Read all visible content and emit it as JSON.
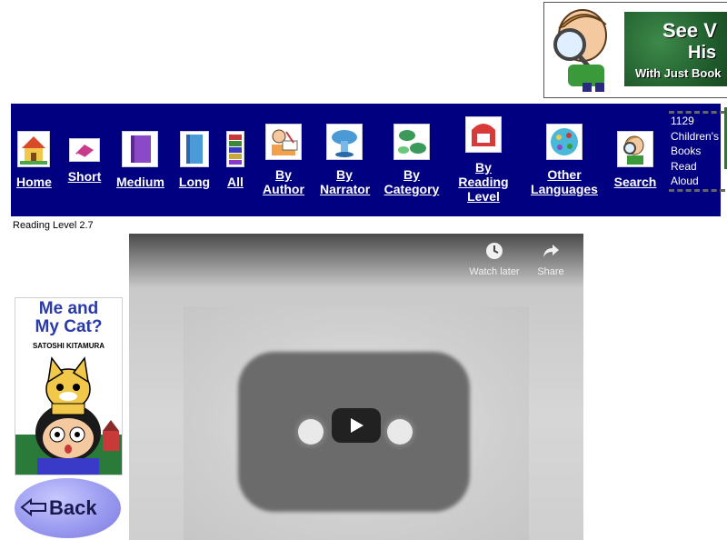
{
  "banner": {
    "line1": "See V",
    "line2": "His",
    "line3": "With Just Book"
  },
  "nav": {
    "items": [
      {
        "label": "Home",
        "icon": "house-icon"
      },
      {
        "label": "Short",
        "icon": "short-book-icon"
      },
      {
        "label": "Medium",
        "icon": "medium-book-icon"
      },
      {
        "label": "Long",
        "icon": "long-book-icon"
      },
      {
        "label": "All",
        "icon": "book-stack-icon"
      },
      {
        "label": "By Author",
        "line1": "By",
        "line2": "Author",
        "icon": "author-icon"
      },
      {
        "label": "By Narrator",
        "line1": "By",
        "line2": "Narrator",
        "icon": "narrator-icon"
      },
      {
        "label": "By Category",
        "line1": "By",
        "line2": "Category",
        "icon": "category-icon"
      },
      {
        "label": "By Reading Level",
        "line1": "By",
        "line2": "Reading",
        "line3": "Level",
        "icon": "reading-level-icon"
      },
      {
        "label": "Other Languages",
        "line1": "Other",
        "line2": "Languages",
        "icon": "globe-icon"
      },
      {
        "label": "Search",
        "icon": "search-detective-icon"
      }
    ],
    "count_lines": [
      "1129",
      "Children's",
      "Books",
      "Read",
      "Aloud"
    ]
  },
  "reading_level": "Reading Level 2.7",
  "video": {
    "watch_later": "Watch later",
    "share": "Share"
  },
  "cover": {
    "title_line1": "Me and",
    "title_line2": "My Cat?",
    "author": "SATOSHI KITAMURA"
  },
  "back_button": {
    "label": "Back"
  }
}
